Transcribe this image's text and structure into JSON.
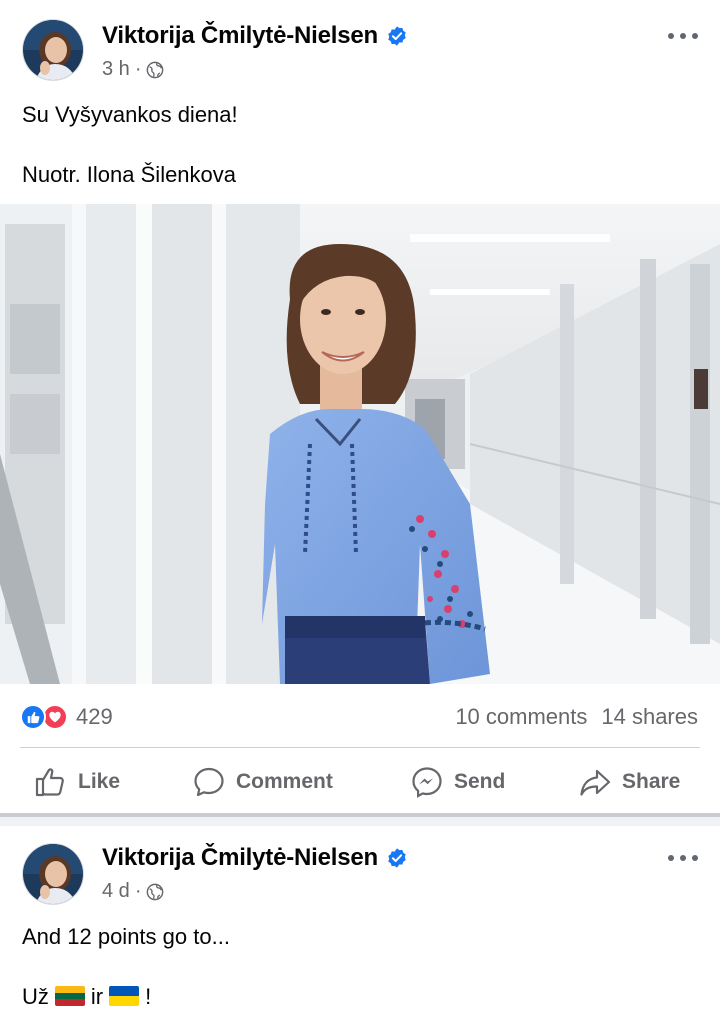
{
  "colors": {
    "accent": "#1877f2",
    "love": "#f33e58",
    "secondary_text": "#65676b"
  },
  "posts": [
    {
      "author": "Viktorija Čmilytė-Nielsen",
      "verified": true,
      "time": "3 h",
      "audience_icon": "globe-icon",
      "text_lines": [
        "Su Vyšyvankos diena!",
        "Nuotr. Ilona Šilenkova"
      ],
      "reactions": {
        "icons": [
          "like-icon",
          "love-icon"
        ],
        "count": "429"
      },
      "comments": "10 comments",
      "shares": "14 shares",
      "actions": [
        "Like",
        "Comment",
        "Send",
        "Share"
      ]
    },
    {
      "author": "Viktorija Čmilytė-Nielsen",
      "verified": true,
      "time": "4 d",
      "audience_icon": "globe-icon",
      "text_line1": "And 12 points go to...",
      "text_line2_prefix": "Už",
      "text_line2_mid": "ir",
      "text_line2_suffix": "!",
      "flags": [
        "lithuania-flag",
        "ukraine-flag"
      ]
    }
  ]
}
